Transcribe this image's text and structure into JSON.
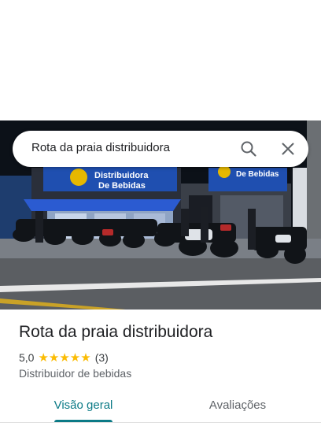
{
  "search": {
    "query": "Rota da praia distribuidora"
  },
  "hero": {
    "sign_line1": "Distribuidora",
    "sign_line2": "De Bebidas",
    "sign_right": "De Bebidas"
  },
  "place": {
    "name": "Rota da praia distribuidora",
    "rating": "5,0",
    "stars": "★★★★★",
    "rating_value": 5.0,
    "review_count": "(3)",
    "category": "Distribuidor de bebidas"
  },
  "tabs": {
    "overview": "Visão geral",
    "reviews": "Avaliações"
  },
  "colors": {
    "accent": "#0b7a86",
    "star": "#fbbc04"
  },
  "icons": {
    "search": "search-icon",
    "close": "close-icon"
  }
}
